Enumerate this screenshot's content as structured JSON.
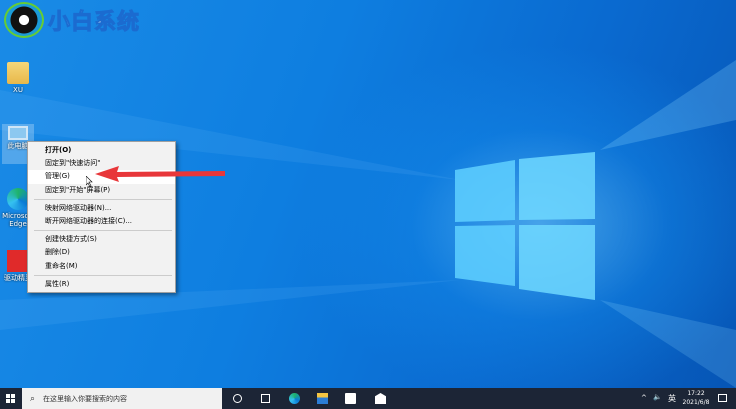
{
  "watermark": {
    "text": "小白系统"
  },
  "desktop_icons": [
    {
      "label": "XU",
      "icon": "user-folder-icon"
    },
    {
      "label": "此电脑",
      "icon": "computer-icon"
    },
    {
      "label": "Microsoft Edge",
      "icon": "edge-icon"
    },
    {
      "label": "驱动精灵",
      "icon": "driver-app-icon"
    }
  ],
  "context_menu": {
    "items": [
      {
        "label": "打开(O)",
        "bold": true
      },
      {
        "label": "固定到\"快速访问\""
      },
      {
        "label": "管理(G)",
        "highlighted": true
      },
      {
        "label": "固定到\"开始\"屏幕(P)"
      },
      {
        "separator": true
      },
      {
        "label": "映射网络驱动器(N)..."
      },
      {
        "label": "断开网络驱动器的连接(C)..."
      },
      {
        "separator": true
      },
      {
        "label": "创建快捷方式(S)"
      },
      {
        "label": "删除(D)"
      },
      {
        "label": "重命名(M)"
      },
      {
        "separator": true
      },
      {
        "label": "属性(R)"
      }
    ]
  },
  "annotation": {
    "arrow_color": "#e8373a"
  },
  "taskbar": {
    "search_placeholder": "在这里输入你要搜索的内容",
    "apps": [
      "cortana-icon",
      "task-view-icon",
      "edge-icon",
      "file-explorer-icon",
      "store-icon",
      "mail-icon"
    ],
    "tray": {
      "chevron": "^",
      "volume": "🔈",
      "ime": "英",
      "time": "17:22",
      "date": "2021/6/8"
    }
  }
}
